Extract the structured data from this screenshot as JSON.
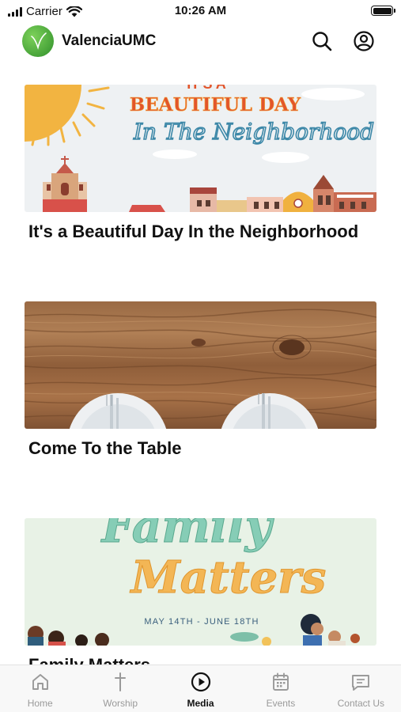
{
  "status_bar": {
    "carrier": "Carrier",
    "time": "10:26 AM"
  },
  "header": {
    "title": "ValenciaUMC",
    "logo_icon": "leaf-logo-icon",
    "search_icon": "search-icon",
    "account_icon": "account-icon"
  },
  "feed": {
    "items": [
      {
        "title": "It's a Beautiful Day In the Neighborhood",
        "banner_line1": "IT'S A",
        "banner_line2": "BEAUTIFUL DAY",
        "banner_line3": "In The Neighborhood"
      },
      {
        "title": "Come To the Table"
      },
      {
        "title": "Family Matters",
        "banner_line1": "Family",
        "banner_line2": "Matters",
        "banner_dates": "MAY 14TH - JUNE 18TH"
      }
    ]
  },
  "tabs": [
    {
      "label": "Home",
      "icon": "home-icon",
      "active": false
    },
    {
      "label": "Worship",
      "icon": "cross-icon",
      "active": false
    },
    {
      "label": "Media",
      "icon": "play-icon",
      "active": true
    },
    {
      "label": "Events",
      "icon": "calendar-icon",
      "active": false
    },
    {
      "label": "Contact Us",
      "icon": "message-icon",
      "active": false
    }
  ],
  "colors": {
    "accent_green": "#3e9e34",
    "active_tab": "#111111",
    "inactive_tab": "#9a9a9a"
  }
}
